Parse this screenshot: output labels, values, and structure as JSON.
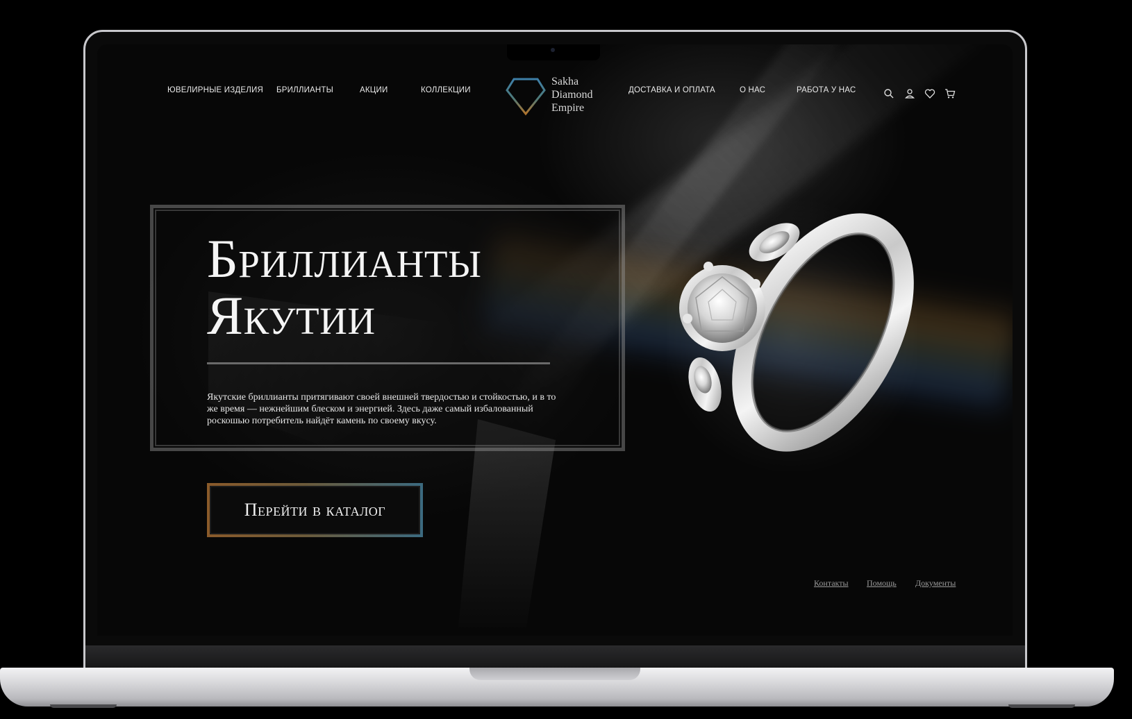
{
  "nav": {
    "left": [
      "Ювелирные изделия",
      "Бриллианты",
      "Акции",
      "Коллекции"
    ],
    "right": [
      "Доставка и оплата",
      "О нас",
      "Работа у нас"
    ],
    "icons": [
      "search-icon",
      "user-icon",
      "heart-icon",
      "cart-icon"
    ]
  },
  "logo": {
    "line1": "Sakha",
    "line2": "Diamond",
    "line3": "Empire"
  },
  "hero": {
    "title_line1": "Бриллианты",
    "title_line2": "Якутии",
    "description": "Якутские бриллианты притягивают своей внешней твердостью и стойкостью, и в то же время — нежнейшим блеском и энергией. Здесь даже самый избалованный роскошью потребитель найдёт камень по своему вкусу.",
    "cta_label": "Перейти в каталог"
  },
  "footer": {
    "links": [
      "Контакты",
      "Помощь",
      "Документы"
    ]
  },
  "colors": {
    "background": "#070707",
    "text": "#f5f5f5",
    "cta_gradient_start": "#8a5a2a",
    "cta_gradient_end": "#3b6a80",
    "logo_blue": "#3e7fa8",
    "logo_gold": "#b0742c"
  }
}
